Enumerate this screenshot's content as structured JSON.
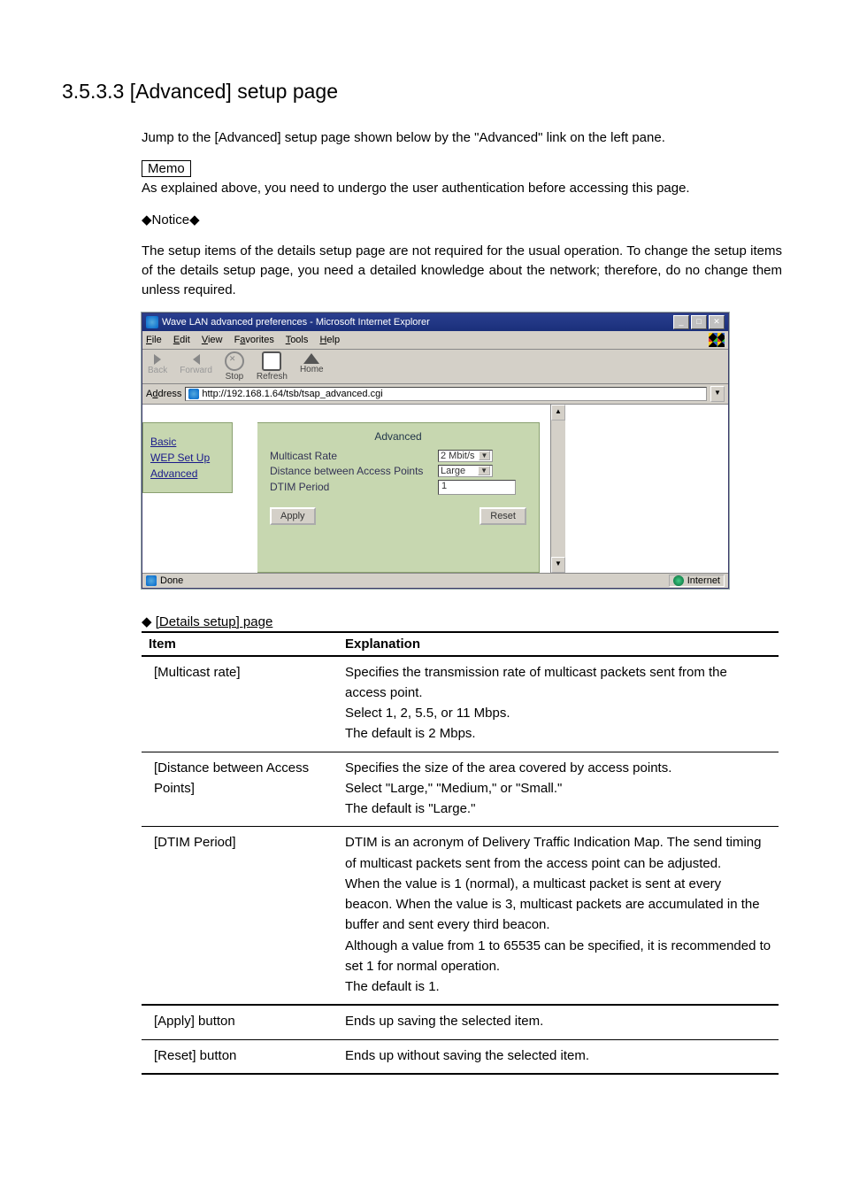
{
  "heading": "3.5.3.3  [Advanced] setup page",
  "intro": "Jump to the [Advanced] setup page shown below by the \"Advanced\" link on the left pane.",
  "memo_label": "Memo",
  "memo_text": "As explained above, you need to undergo the user authentication before accessing this page.",
  "notice_label": "Notice",
  "notice_text": "The setup items of the details setup page are not required for the usual operation.   To change the setup items of the details setup page, you need a detailed knowledge about the network; therefore, do no change them unless required.",
  "browser": {
    "title": "Wave LAN advanced preferences - Microsoft Internet Explorer",
    "menus": [
      "File",
      "Edit",
      "View",
      "Favorites",
      "Tools",
      "Help"
    ],
    "toolbar": {
      "back": "Back",
      "forward": "Forward",
      "stop": "Stop",
      "refresh": "Refresh",
      "home": "Home"
    },
    "address_label": "Address",
    "address_value": "http://192.168.1.64/tsb/tsap_advanced.cgi",
    "nav": {
      "basic": "Basic",
      "wep": "WEP Set Up",
      "advanced": "Advanced"
    },
    "panel": {
      "heading": "Advanced",
      "multicast_label": "Multicast Rate",
      "multicast_value": "2 Mbit/s",
      "distance_label": "Distance between Access Points",
      "distance_value": "Large",
      "dtim_label": "DTIM Period",
      "dtim_value": "1",
      "apply": "Apply",
      "reset": "Reset"
    },
    "status_done": "Done",
    "status_zone": "Internet"
  },
  "details": {
    "caption": "[Details setup] page",
    "head_item": "Item",
    "head_exp": "Explanation",
    "rows": [
      {
        "item": "[Multicast rate]",
        "exp": "Specifies the transmission rate of multicast packets sent from the access point.\nSelect 1, 2, 5.5, or 11 Mbps.\nThe default is 2 Mbps."
      },
      {
        "item": "[Distance between Access Points]",
        "exp": "Specifies the size of the area covered by access points.\nSelect \"Large,\" \"Medium,\" or \"Small.\"\nThe default is \"Large.\""
      },
      {
        "item": "[DTIM Period]",
        "exp": "DTIM is an acronym of Delivery Traffic Indication Map.  The send timing of multicast packets sent from the access point can be adjusted.\nWhen the value is 1 (normal), a multicast packet is sent at every beacon.    When the value is 3, multicast packets are accumulated in the buffer and sent every third beacon.\nAlthough a value from 1 to 65535 can be specified, it is recommended to set 1 for normal operation.\nThe default is 1."
      },
      {
        "item": "[Apply] button",
        "exp": "Ends up saving the selected item."
      },
      {
        "item": "[Reset] button",
        "exp": "Ends up without saving the selected item."
      }
    ]
  }
}
